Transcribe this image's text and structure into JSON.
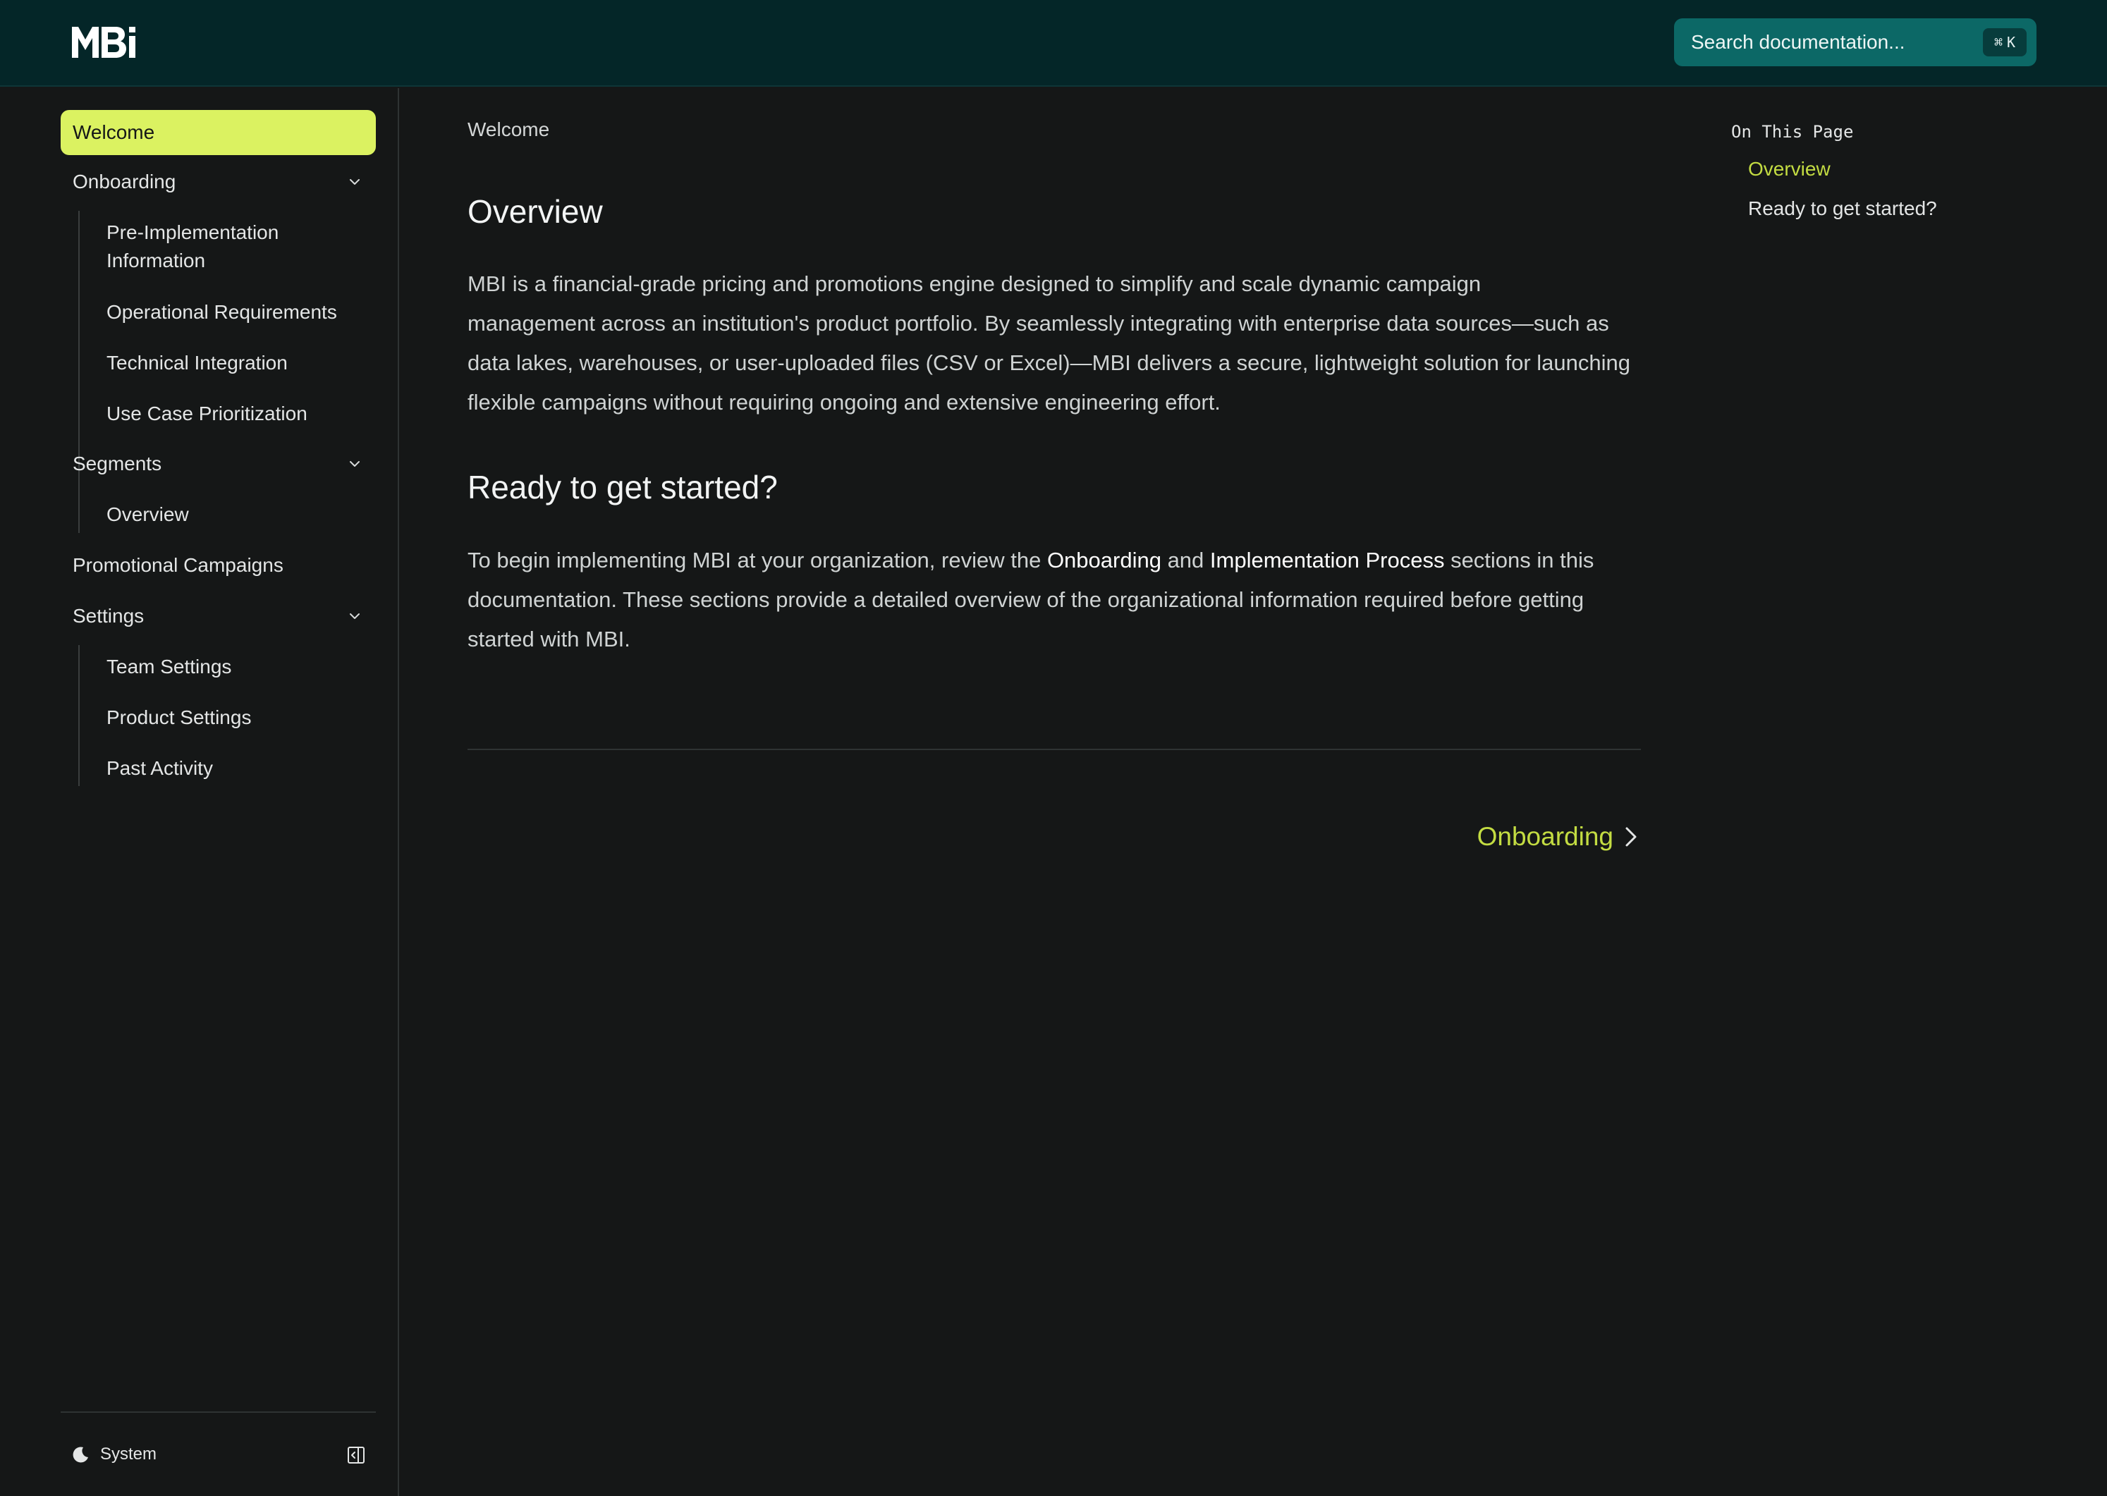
{
  "app": {
    "logo_text": "MBI"
  },
  "search": {
    "placeholder": "Search documentation...",
    "shortcut_symbol": "⌘",
    "shortcut_key": "K"
  },
  "sidebar": {
    "welcome": "Welcome",
    "onboarding": {
      "label": "Onboarding",
      "items": [
        "Pre-Implementation",
        "Information",
        "Operational Requirements",
        "Technical Integration",
        "Use Case Prioritization"
      ]
    },
    "segments": {
      "label": "Segments",
      "items": [
        "Overview"
      ]
    },
    "promotional_campaigns": "Promotional Campaigns",
    "settings": {
      "label": "Settings",
      "items": [
        "Team Settings",
        "Product Settings",
        "Past Activity"
      ]
    },
    "theme_label": "System"
  },
  "main": {
    "breadcrumb": "Welcome",
    "overview_title": "Overview",
    "overview_lines": [
      "MBI is a financial-grade pricing and promotions engine designed to simplify and scale dynamic campaign",
      "management across an institution's product portfolio. By seamlessly integrating with enterprise data sources—such as",
      "data lakes, warehouses, or user-uploaded files (CSV or Excel)—MBI delivers a secure, lightweight solution for launching",
      "flexible campaigns without requiring ongoing and extensive engineering effort."
    ],
    "ready_title": "Ready to get started?",
    "ready_line1_pre": "To begin implementing MBI at your organization, review the ",
    "ready_link1": "Onboarding",
    "ready_line1_mid": " and ",
    "ready_link2": "Implementation Process",
    "ready_line1_post": " sections in this",
    "ready_line2": "documentation. These sections provide a detailed overview of the organizational information required before getting",
    "ready_line3": "started with MBI.",
    "next_label": "Onboarding"
  },
  "toc": {
    "title": "On This Page",
    "items": [
      "Overview",
      "Ready to get started?"
    ]
  },
  "colors": {
    "header_bg": "#042628",
    "accent": "#dbf261",
    "accent_text": "#c3dc42",
    "search_bg": "#0c6866",
    "body_bg": "#151717"
  }
}
